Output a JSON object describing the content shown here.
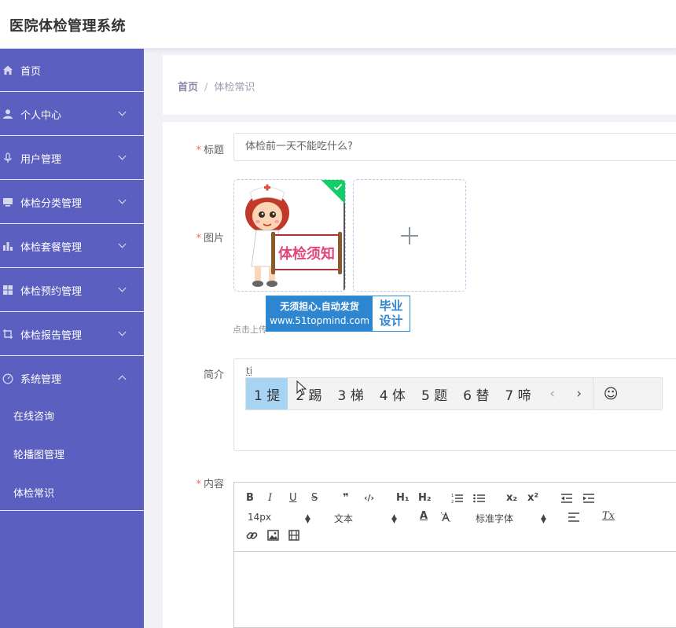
{
  "header": {
    "app_title": "医院体检管理系统"
  },
  "sidebar": {
    "items": [
      {
        "label": "首页"
      },
      {
        "label": "个人中心"
      },
      {
        "label": "用户管理"
      },
      {
        "label": "体检分类管理"
      },
      {
        "label": "体检套餐管理"
      },
      {
        "label": "体检预约管理"
      },
      {
        "label": "体检报告管理"
      },
      {
        "label": "系统管理"
      }
    ],
    "subitems": [
      {
        "label": "在线咨询"
      },
      {
        "label": "轮播图管理"
      },
      {
        "label": "体检常识"
      }
    ]
  },
  "breadcrumb": {
    "home": "首页",
    "separator": "/",
    "current": "体检常识"
  },
  "form": {
    "title_label": "标题",
    "title_value": "体检前一天不能吃什么?",
    "image_label": "图片",
    "image_text": "体检须知",
    "upload_tip": "点击上传",
    "summary_label": "简介",
    "summary_value": "ti",
    "content_label": "内容",
    "required_mark": "*"
  },
  "watermark": {
    "line1": "无须担心.自动发货",
    "line2": "www.51topmind.com",
    "badge_line1": "毕业",
    "badge_line2": "设计"
  },
  "ime": {
    "candidates": [
      "1 提",
      "2 踢",
      "3 梯",
      "4 体",
      "5 题",
      "6 替",
      "7 啼"
    ],
    "prev": "‹",
    "next": "›",
    "emoji": "☺"
  },
  "editor": {
    "bold": "B",
    "italic": "I",
    "underline": "U",
    "strike": "S",
    "quote": "❞",
    "code": "‹/›",
    "h1": "H₁",
    "h2": "H₂",
    "subscript": "x₂",
    "superscript": "x²",
    "size": "14px",
    "text_style": "文本",
    "font": "标准字体",
    "font_color": "A",
    "clear_format": "Tx"
  },
  "colors": {
    "sidebar": "#5b5fc0",
    "accent_check": "#13ce66",
    "required": "#f56c6c",
    "ime_selected": "#a8d4f4"
  }
}
